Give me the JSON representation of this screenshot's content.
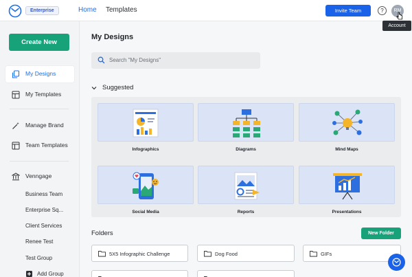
{
  "topbar": {
    "badge": "Enterprise",
    "nav": {
      "home": "Home",
      "templates": "Templates"
    },
    "invite_button": "Invite Team",
    "help_symbol": "?",
    "avatar_initials": "RM",
    "tooltip": "Account"
  },
  "sidebar": {
    "create_button": "Create New",
    "items": [
      {
        "label": "My Designs",
        "icon": "copy-icon",
        "active": true
      },
      {
        "label": "My Templates",
        "icon": "template-icon"
      },
      {
        "label": "Manage Brand",
        "icon": "magic-wand-icon"
      },
      {
        "label": "Team Templates",
        "icon": "layout-icon"
      },
      {
        "label": "Venngage",
        "icon": "bank-icon"
      }
    ],
    "teams": [
      "Business Team",
      "Enterprise Sq...",
      "Client Services",
      "Renee Test",
      "Test Group",
      "Add Group"
    ]
  },
  "main": {
    "title": "My Designs",
    "search_placeholder": "Search \"My Designs\"",
    "suggested_label": "Suggested",
    "suggested": [
      {
        "label": "Infographics"
      },
      {
        "label": "Diagrams"
      },
      {
        "label": "Mind Maps"
      },
      {
        "label": "Social Media"
      },
      {
        "label": "Reports"
      },
      {
        "label": "Presentations"
      }
    ],
    "folders_label": "Folders",
    "new_folder_button": "New Folder",
    "folders": [
      "5X5 Infographic Challenge",
      "Dog Food",
      "GIFs"
    ]
  },
  "colors": {
    "primary_blue": "#1a63e8",
    "green": "#17a27a",
    "card_bg": "#dbe4f7"
  }
}
